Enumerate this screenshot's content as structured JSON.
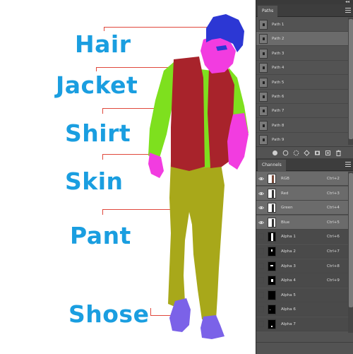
{
  "canvas": {
    "labels": [
      "Hair",
      "Jacket",
      "Shirt",
      "Skin",
      "Pant",
      "Shose"
    ],
    "mask_colors": {
      "hair": "#2c37d4",
      "jacket": "#a8232b",
      "shirt": "#7ee01e",
      "skin": "#f23ce0",
      "pant": "#a8a81a",
      "shoes": "#7b62e8",
      "label": "#1a9ee0",
      "leader": "#e0483c"
    }
  },
  "paths_panel": {
    "tab": "Paths",
    "items": [
      "Path 1",
      "Path 2",
      "Path 3",
      "Path 4",
      "Path 5",
      "Path 6",
      "Path 7",
      "Path 8",
      "Path 9"
    ],
    "selected": "Path 2",
    "footer_icons": [
      "fill-path-icon",
      "stroke-path-icon",
      "load-selection-icon",
      "make-work-path-icon",
      "add-mask-icon",
      "new-path-icon",
      "delete-path-icon"
    ]
  },
  "channels_panel": {
    "tab": "Channels",
    "items": [
      {
        "name": "RGB",
        "shortcut": "Ctrl+2"
      },
      {
        "name": "Red",
        "shortcut": "Ctrl+3"
      },
      {
        "name": "Green",
        "shortcut": "Ctrl+4"
      },
      {
        "name": "Blue",
        "shortcut": "Ctrl+5"
      },
      {
        "name": "Alpha 1",
        "shortcut": "Ctrl+6"
      },
      {
        "name": "Alpha 2",
        "shortcut": "Ctrl+7"
      },
      {
        "name": "Alpha 3",
        "shortcut": "Ctrl+8"
      },
      {
        "name": "Alpha 4",
        "shortcut": "Ctrl+9"
      },
      {
        "name": "Alpha 5",
        "shortcut": ""
      },
      {
        "name": "Alpha 6",
        "shortcut": ""
      },
      {
        "name": "Alpha 7",
        "shortcut": ""
      }
    ]
  },
  "dock": {
    "collapse_glyph": "◂◂"
  }
}
